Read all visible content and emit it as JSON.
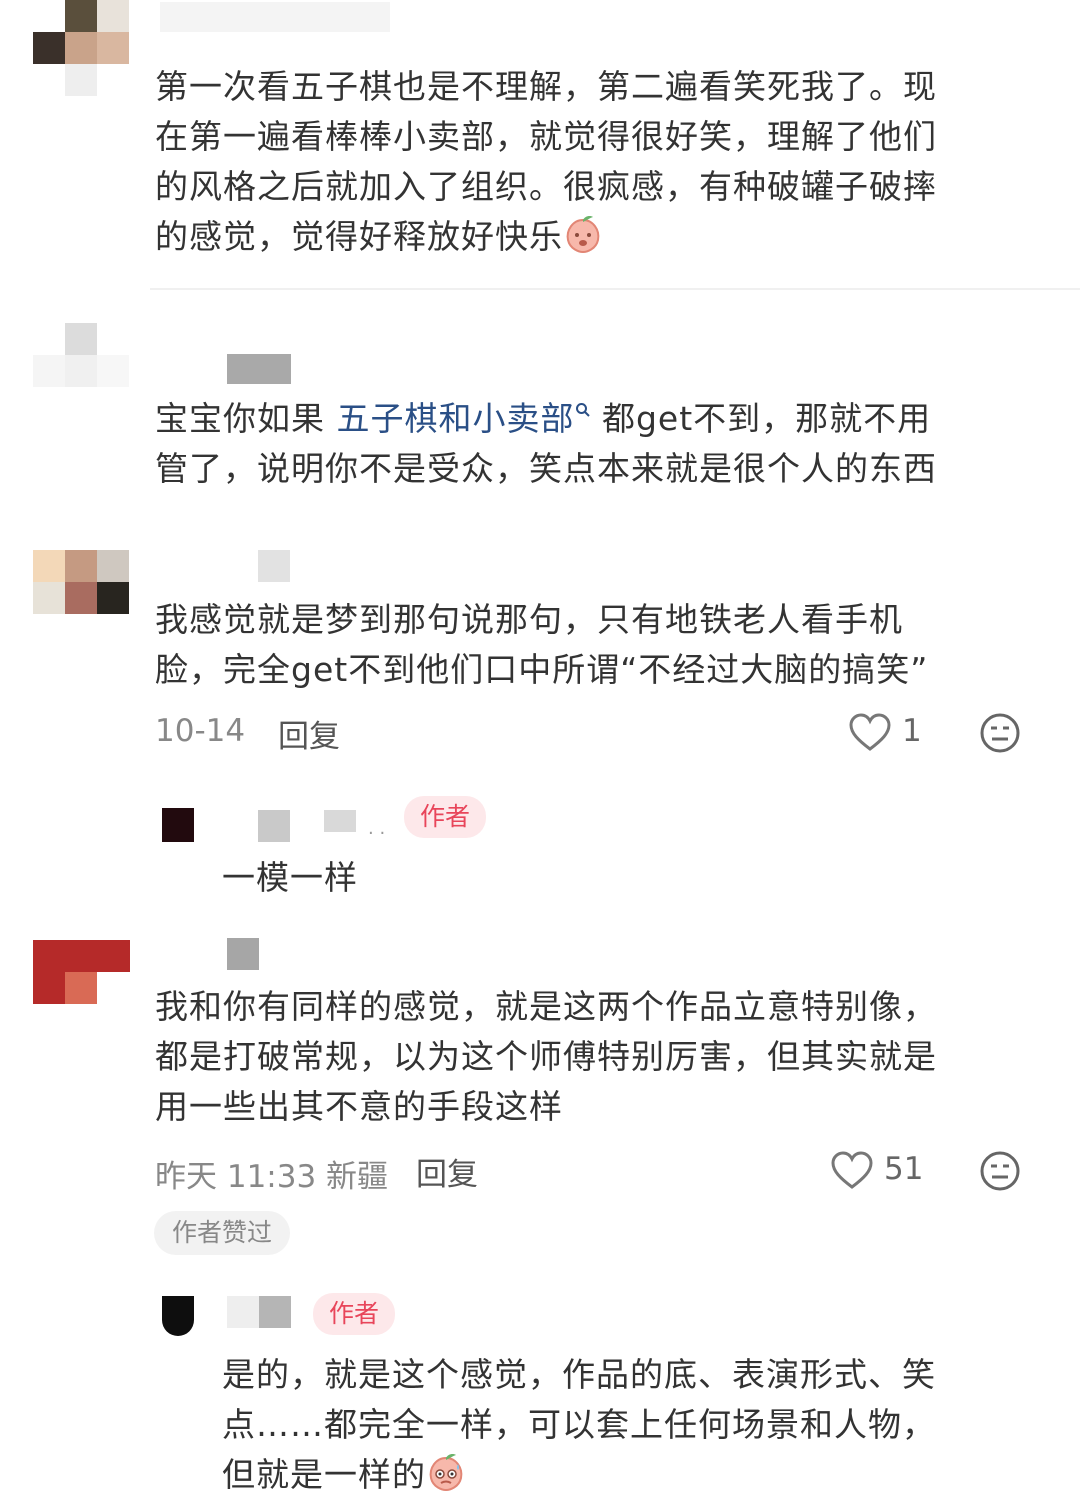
{
  "comments": [
    {
      "text": "第一次看五子棋也是不理解，第二遍看笑死我了。现在第一遍看棒棒小卖部，就觉得很好笑，理解了他们的风格之后就加入了组织。很疯感，有种破罐子破摔的感觉，觉得好释放好快乐",
      "lines": [
        "第一次看五子棋也是不理解，第二遍看笑死我了。现",
        "在第一遍看棒棒小卖部，就觉得很好笑，理解了他们",
        "的风格之后就加入了组织。很疯感，有种破罐子破摔",
        "的感觉，觉得好释放好快乐"
      ],
      "emoji": "peach-face-emoji"
    },
    {
      "text_before": "宝宝你如果 ",
      "link": "五子棋和小卖部",
      "text_after": " 都get不到，那就不用",
      "line2": "管了，说明你不是受众，笑点本来就是很个人的东西"
    },
    {
      "lines": [
        "我感觉就是梦到那句说那句，只有地铁老人看手机",
        "脸，完全get不到他们口中所谓“不经过大脑的搞笑”"
      ],
      "date": "10-14",
      "reply_label": "回复",
      "likes": "1",
      "reply": {
        "tag": "作者",
        "text": "一模一样"
      }
    },
    {
      "lines": [
        "我和你有同样的感觉，就是这两个作品立意特别像，",
        "都是打破常规，以为这个师傅特别厉害，但其实就是",
        "用一些出其不意的手段这样"
      ],
      "date": "昨天 11:33 新疆",
      "reply_label": "回复",
      "likes": "51",
      "badge": "作者赞过",
      "reply": {
        "tag": "作者",
        "lines": [
          "是的，就是这个感觉，作品的底、表演形式、笑",
          "点……都完全一样，可以套上任何场景和人物，",
          "但就是一样的"
        ],
        "emoji": "peach-face-emoji"
      }
    }
  ],
  "colors": {
    "link": "#2a4f86",
    "tag_bg": "#fde8ea",
    "tag_text": "#e8455a"
  }
}
